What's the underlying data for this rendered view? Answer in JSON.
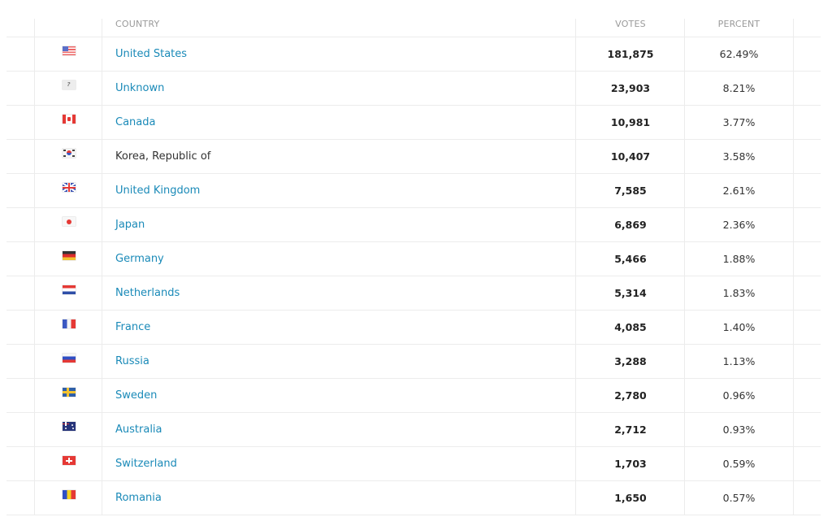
{
  "table": {
    "headers": {
      "country": "COUNTRY",
      "votes": "VOTES",
      "percent": "PERCENT"
    },
    "rows": [
      {
        "flag": "us-flag-icon",
        "country": "United States",
        "linked": true,
        "votes": "181,875",
        "percent": "62.49%"
      },
      {
        "flag": "unknown-flag-icon",
        "country": "Unknown",
        "linked": true,
        "votes": "23,903",
        "percent": "8.21%"
      },
      {
        "flag": "canada-flag-icon",
        "country": "Canada",
        "linked": true,
        "votes": "10,981",
        "percent": "3.77%"
      },
      {
        "flag": "korea-flag-icon",
        "country": "Korea, Republic of",
        "linked": false,
        "votes": "10,407",
        "percent": "3.58%"
      },
      {
        "flag": "uk-flag-icon",
        "country": "United Kingdom",
        "linked": true,
        "votes": "7,585",
        "percent": "2.61%"
      },
      {
        "flag": "japan-flag-icon",
        "country": "Japan",
        "linked": true,
        "votes": "6,869",
        "percent": "2.36%"
      },
      {
        "flag": "germany-flag-icon",
        "country": "Germany",
        "linked": true,
        "votes": "5,466",
        "percent": "1.88%"
      },
      {
        "flag": "netherlands-flag-icon",
        "country": "Netherlands",
        "linked": true,
        "votes": "5,314",
        "percent": "1.83%"
      },
      {
        "flag": "france-flag-icon",
        "country": "France",
        "linked": true,
        "votes": "4,085",
        "percent": "1.40%"
      },
      {
        "flag": "russia-flag-icon",
        "country": "Russia",
        "linked": true,
        "votes": "3,288",
        "percent": "1.13%"
      },
      {
        "flag": "sweden-flag-icon",
        "country": "Sweden",
        "linked": true,
        "votes": "2,780",
        "percent": "0.96%"
      },
      {
        "flag": "australia-flag-icon",
        "country": "Australia",
        "linked": true,
        "votes": "2,712",
        "percent": "0.93%"
      },
      {
        "flag": "switzerland-flag-icon",
        "country": "Switzerland",
        "linked": true,
        "votes": "1,703",
        "percent": "0.59%"
      },
      {
        "flag": "romania-flag-icon",
        "country": "Romania",
        "linked": true,
        "votes": "1,650",
        "percent": "0.57%"
      }
    ]
  },
  "colors": {
    "link": "#1a8ab8",
    "header_text": "#9a9a9a",
    "grid": "#ececec"
  }
}
